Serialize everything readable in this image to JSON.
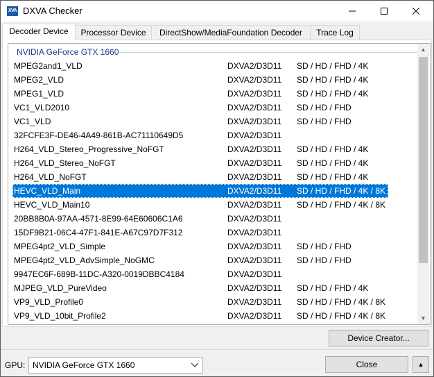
{
  "window": {
    "title": "DXVA Checker",
    "icon_text": "XVA"
  },
  "tabs": [
    {
      "label": "Decoder Device",
      "active": true
    },
    {
      "label": "Processor Device",
      "active": false
    },
    {
      "label": "DirectShow/MediaFoundation Decoder",
      "active": false
    },
    {
      "label": "Trace Log",
      "active": false
    }
  ],
  "list": {
    "group": "NVIDIA GeForce GTX 1660",
    "selected_index": 9,
    "rows": [
      {
        "name": "MPEG2and1_VLD",
        "api": "DXVA2/D3D11",
        "res": "SD / HD / FHD / 4K"
      },
      {
        "name": "MPEG2_VLD",
        "api": "DXVA2/D3D11",
        "res": "SD / HD / FHD / 4K"
      },
      {
        "name": "MPEG1_VLD",
        "api": "DXVA2/D3D11",
        "res": "SD / HD / FHD / 4K"
      },
      {
        "name": "VC1_VLD2010",
        "api": "DXVA2/D3D11",
        "res": "SD / HD / FHD"
      },
      {
        "name": "VC1_VLD",
        "api": "DXVA2/D3D11",
        "res": "SD / HD / FHD"
      },
      {
        "name": "32FCFE3F-DE46-4A49-861B-AC71110649D5",
        "api": "DXVA2/D3D11",
        "res": ""
      },
      {
        "name": "H264_VLD_Stereo_Progressive_NoFGT",
        "api": "DXVA2/D3D11",
        "res": "SD / HD / FHD / 4K"
      },
      {
        "name": "H264_VLD_Stereo_NoFGT",
        "api": "DXVA2/D3D11",
        "res": "SD / HD / FHD / 4K"
      },
      {
        "name": "H264_VLD_NoFGT",
        "api": "DXVA2/D3D11",
        "res": "SD / HD / FHD / 4K"
      },
      {
        "name": "HEVC_VLD_Main",
        "api": "DXVA2/D3D11",
        "res": "SD / HD / FHD / 4K / 8K"
      },
      {
        "name": "HEVC_VLD_Main10",
        "api": "DXVA2/D3D11",
        "res": "SD / HD / FHD / 4K / 8K"
      },
      {
        "name": "20BB8B0A-97AA-4571-8E99-64E60606C1A6",
        "api": "DXVA2/D3D11",
        "res": ""
      },
      {
        "name": "15DF9B21-06C4-47F1-841E-A67C97D7F312",
        "api": "DXVA2/D3D11",
        "res": ""
      },
      {
        "name": "MPEG4pt2_VLD_Simple",
        "api": "DXVA2/D3D11",
        "res": "SD / HD / FHD"
      },
      {
        "name": "MPEG4pt2_VLD_AdvSimple_NoGMC",
        "api": "DXVA2/D3D11",
        "res": "SD / HD / FHD"
      },
      {
        "name": "9947EC6F-689B-11DC-A320-0019DBBC4184",
        "api": "DXVA2/D3D11",
        "res": ""
      },
      {
        "name": "MJPEG_VLD_PureVideo",
        "api": "DXVA2/D3D11",
        "res": "SD / HD / FHD / 4K"
      },
      {
        "name": "VP9_VLD_Profile0",
        "api": "DXVA2/D3D11",
        "res": "SD / HD / FHD / 4K / 8K"
      },
      {
        "name": "VP9_VLD_10bit_Profile2",
        "api": "DXVA2/D3D11",
        "res": "SD / HD / FHD / 4K / 8K"
      }
    ]
  },
  "buttons": {
    "device_creator": "Device Creator...",
    "close": "Close",
    "up_arrow": "▲"
  },
  "gpu": {
    "label": "GPU:",
    "selected": "NVIDIA GeForce GTX 1660"
  },
  "colors": {
    "selection": "#0078d7",
    "group_header": "#1e3a8a"
  }
}
